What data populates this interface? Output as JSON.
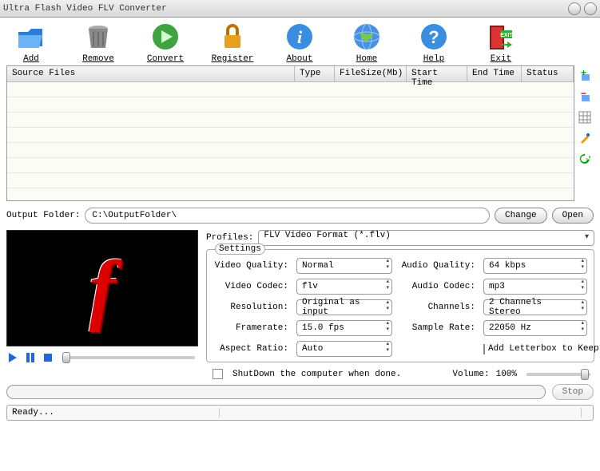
{
  "window": {
    "title": "Ultra Flash Video FLV Converter"
  },
  "toolbar": [
    {
      "id": "add",
      "label": "Add"
    },
    {
      "id": "remove",
      "label": "Remove"
    },
    {
      "id": "convert",
      "label": "Convert"
    },
    {
      "id": "register",
      "label": "Register"
    },
    {
      "id": "about",
      "label": "About"
    },
    {
      "id": "home",
      "label": "Home"
    },
    {
      "id": "help",
      "label": "Help"
    },
    {
      "id": "exit",
      "label": "Exit"
    }
  ],
  "columns": {
    "source": "Source Files",
    "type": "Type",
    "filesize": "FileSize(Mb)",
    "start": "Start Time",
    "end": "End Time",
    "status": "Status"
  },
  "output": {
    "label": "Output Folder:",
    "value": "C:\\OutputFolder\\",
    "change": "Change",
    "open": "Open"
  },
  "profiles": {
    "label": "Profiles:",
    "value": "FLV Video Format (*.flv)"
  },
  "settings": {
    "legend": "Settings",
    "video_quality_lbl": "Video Quality:",
    "video_quality": "Normal",
    "video_codec_lbl": "Video Codec:",
    "video_codec": "flv",
    "resolution_lbl": "Resolution:",
    "resolution": "Original as input",
    "framerate_lbl": "Framerate:",
    "framerate": "15.0   fps",
    "aspect_lbl": "Aspect Ratio:",
    "aspect": "Auto",
    "audio_quality_lbl": "Audio Quality:",
    "audio_quality": "64   kbps",
    "audio_codec_lbl": "Audio Codec:",
    "audio_codec": "mp3",
    "channels_lbl": "Channels:",
    "channels": "2 Channels Stereo",
    "samplerate_lbl": "Sample Rate:",
    "samplerate": "22050 Hz",
    "letterbox": "Add Letterbox to Keep Aspect"
  },
  "bottom": {
    "shutdown": "ShutDown the computer when done.",
    "volume_lbl": "Volume:",
    "volume_val": "100%",
    "stop": "Stop"
  },
  "status": "Ready..."
}
